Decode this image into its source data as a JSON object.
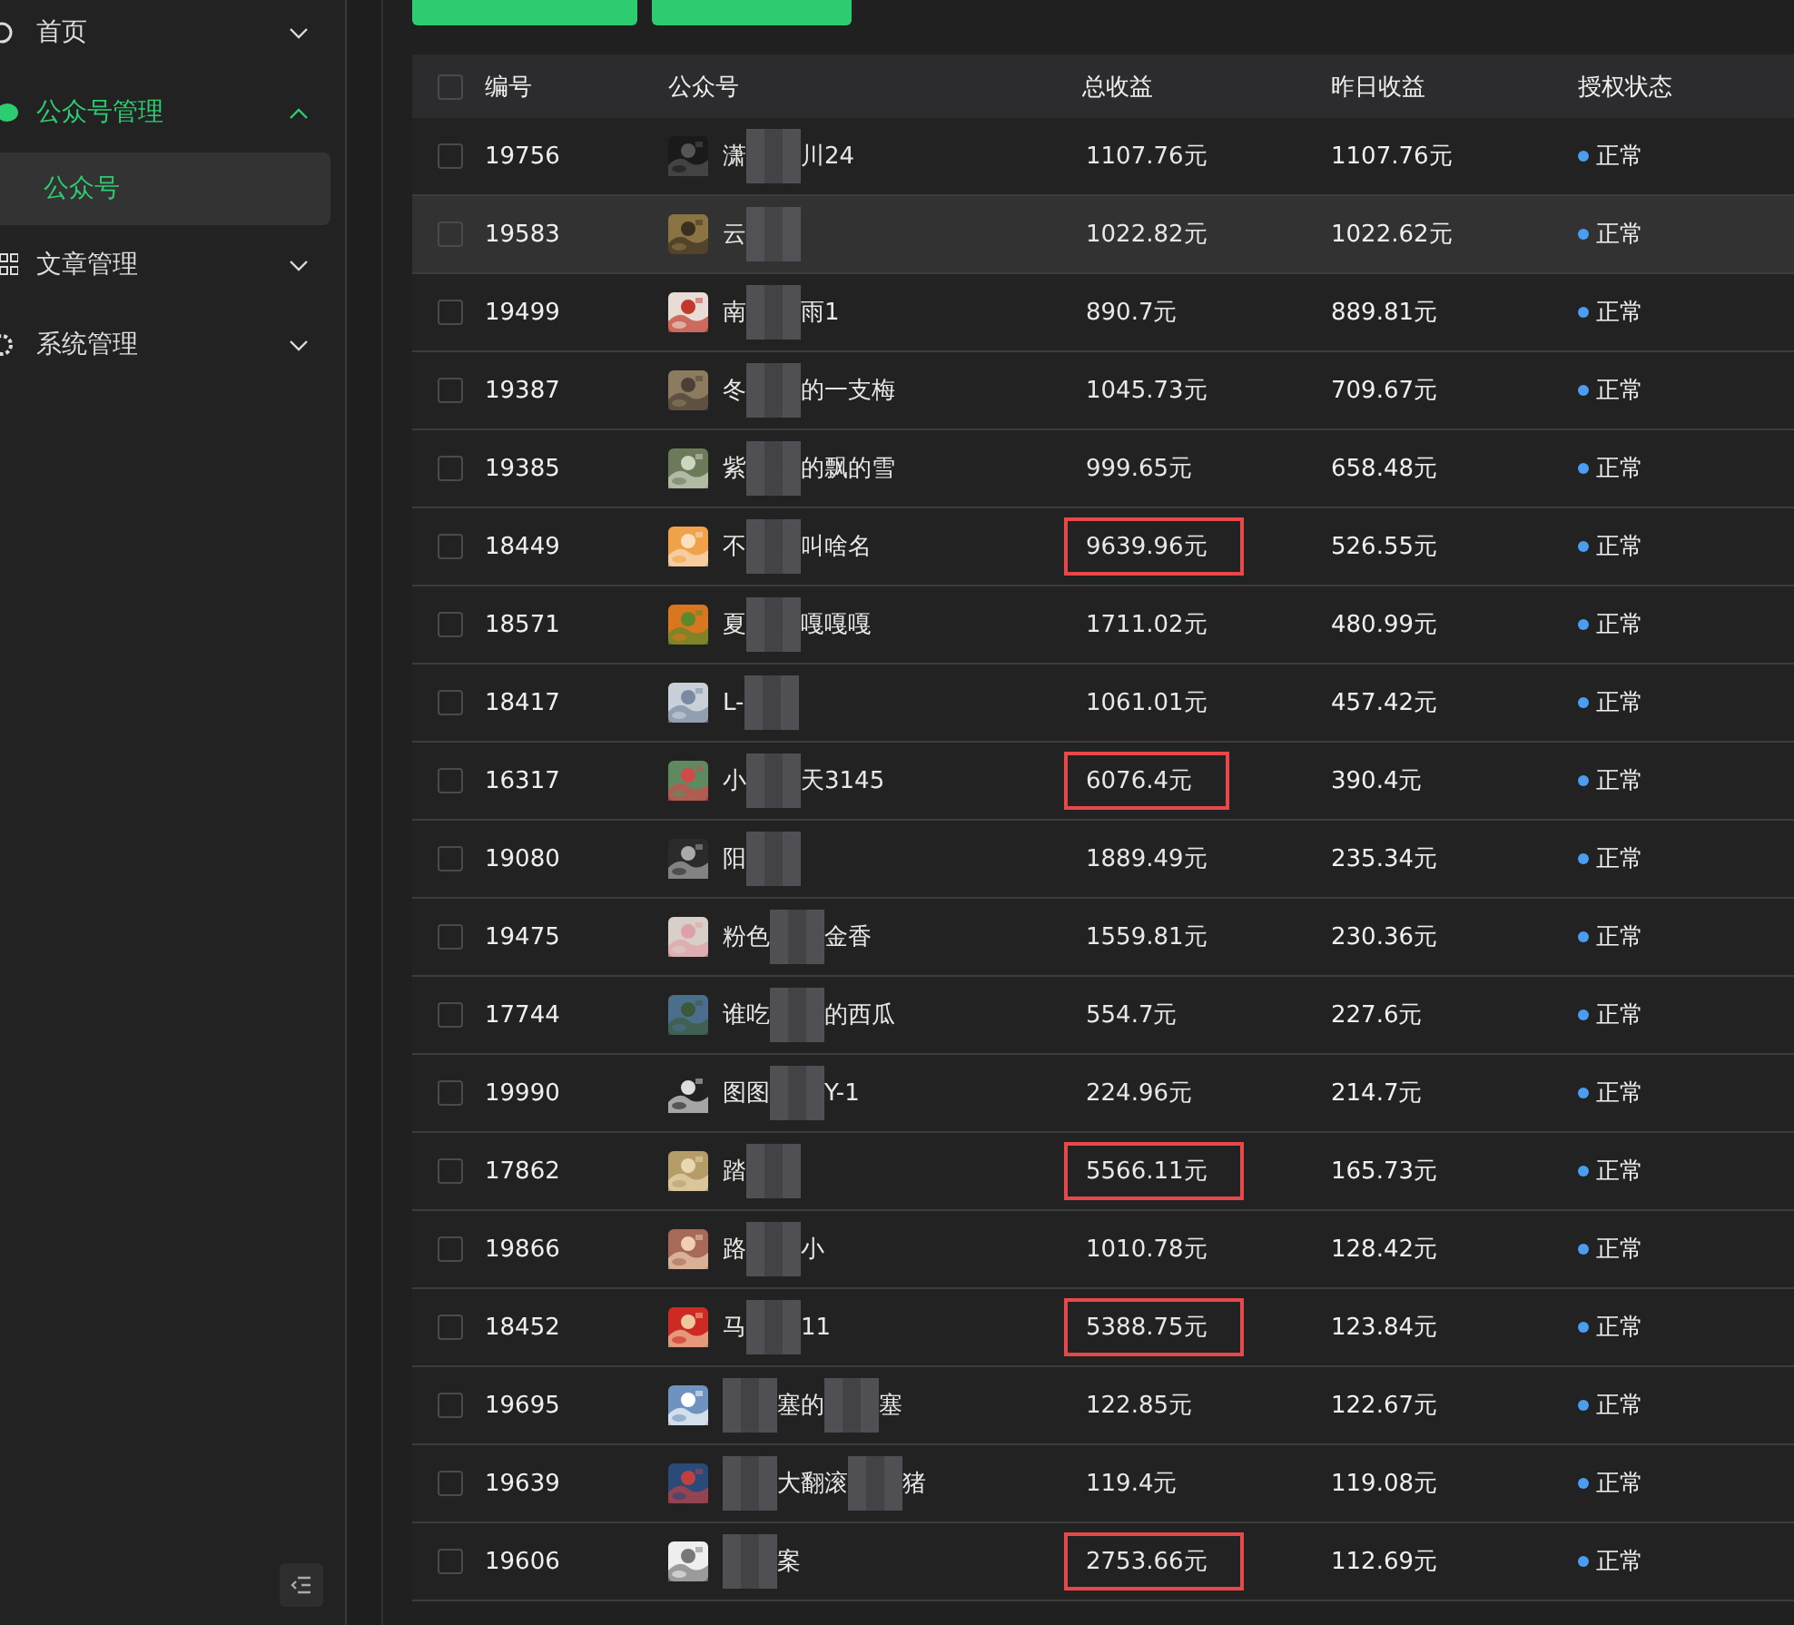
{
  "sidebar": {
    "items": [
      {
        "label": "首页",
        "kind": "home",
        "expanded": false,
        "active": false
      },
      {
        "label": "公众号管理",
        "kind": "wechat",
        "expanded": true,
        "active": true,
        "children": [
          {
            "label": "公众号",
            "selected": true
          }
        ]
      },
      {
        "label": "文章管理",
        "kind": "grid",
        "expanded": false,
        "active": false
      },
      {
        "label": "系统管理",
        "kind": "gear",
        "expanded": false,
        "active": false
      }
    ]
  },
  "table": {
    "select_all_checked": false,
    "columns": [
      "编号",
      "公众号",
      "总收益",
      "昨日收益",
      "授权状态"
    ],
    "rows": [
      {
        "id": "19756",
        "name": [
          {
            "kind": "text",
            "text": "潇"
          },
          {
            "kind": "blur"
          },
          {
            "kind": "text",
            "text": "川24"
          }
        ],
        "total": "1107.76元",
        "highlighted": false,
        "yesterday": "1107.76元",
        "status": "正常",
        "hovered": false,
        "checked": false
      },
      {
        "id": "19583",
        "name": [
          {
            "kind": "text",
            "text": "云"
          },
          {
            "kind": "blur"
          }
        ],
        "total": "1022.82元",
        "highlighted": false,
        "yesterday": "1022.62元",
        "status": "正常",
        "hovered": true,
        "checked": false
      },
      {
        "id": "19499",
        "name": [
          {
            "kind": "text",
            "text": "南"
          },
          {
            "kind": "blur"
          },
          {
            "kind": "text",
            "text": "雨1"
          }
        ],
        "total": "890.7元",
        "highlighted": false,
        "yesterday": "889.81元",
        "status": "正常",
        "hovered": false,
        "checked": false
      },
      {
        "id": "19387",
        "name": [
          {
            "kind": "text",
            "text": "冬"
          },
          {
            "kind": "blur"
          },
          {
            "kind": "text",
            "text": "的一支梅"
          }
        ],
        "total": "1045.73元",
        "highlighted": false,
        "yesterday": "709.67元",
        "status": "正常",
        "hovered": false,
        "checked": false
      },
      {
        "id": "19385",
        "name": [
          {
            "kind": "text",
            "text": "紫"
          },
          {
            "kind": "blur"
          },
          {
            "kind": "text",
            "text": "的飘的雪"
          }
        ],
        "total": "999.65元",
        "highlighted": false,
        "yesterday": "658.48元",
        "status": "正常",
        "hovered": false,
        "checked": false
      },
      {
        "id": "18449",
        "name": [
          {
            "kind": "text",
            "text": "不"
          },
          {
            "kind": "blur"
          },
          {
            "kind": "text",
            "text": "叫啥名"
          }
        ],
        "total": "9639.96元",
        "highlighted": true,
        "yesterday": "526.55元",
        "status": "正常",
        "hovered": false,
        "checked": false
      },
      {
        "id": "18571",
        "name": [
          {
            "kind": "text",
            "text": "夏"
          },
          {
            "kind": "blur"
          },
          {
            "kind": "text",
            "text": "嘎嘎嘎"
          }
        ],
        "total": "1711.02元",
        "highlighted": false,
        "yesterday": "480.99元",
        "status": "正常",
        "hovered": false,
        "checked": false
      },
      {
        "id": "18417",
        "name": [
          {
            "kind": "text",
            "text": "L-"
          },
          {
            "kind": "blur"
          }
        ],
        "total": "1061.01元",
        "highlighted": false,
        "yesterday": "457.42元",
        "status": "正常",
        "hovered": false,
        "checked": false
      },
      {
        "id": "16317",
        "name": [
          {
            "kind": "text",
            "text": "小"
          },
          {
            "kind": "blur"
          },
          {
            "kind": "text",
            "text": "天3145"
          }
        ],
        "total": "6076.4元",
        "highlighted": true,
        "yesterday": "390.4元",
        "status": "正常",
        "hovered": false,
        "checked": false
      },
      {
        "id": "19080",
        "name": [
          {
            "kind": "text",
            "text": "阳"
          },
          {
            "kind": "blur"
          }
        ],
        "total": "1889.49元",
        "highlighted": false,
        "yesterday": "235.34元",
        "status": "正常",
        "hovered": false,
        "checked": false
      },
      {
        "id": "19475",
        "name": [
          {
            "kind": "text",
            "text": "粉色"
          },
          {
            "kind": "blur"
          },
          {
            "kind": "text",
            "text": "金香"
          }
        ],
        "total": "1559.81元",
        "highlighted": false,
        "yesterday": "230.36元",
        "status": "正常",
        "hovered": false,
        "checked": false
      },
      {
        "id": "17744",
        "name": [
          {
            "kind": "text",
            "text": "谁吃"
          },
          {
            "kind": "blur"
          },
          {
            "kind": "text",
            "text": "的西瓜"
          }
        ],
        "total": "554.7元",
        "highlighted": false,
        "yesterday": "227.6元",
        "status": "正常",
        "hovered": false,
        "checked": false
      },
      {
        "id": "19990",
        "name": [
          {
            "kind": "text",
            "text": "图图"
          },
          {
            "kind": "blur"
          },
          {
            "kind": "text",
            "text": "Y-1"
          }
        ],
        "total": "224.96元",
        "highlighted": false,
        "yesterday": "214.7元",
        "status": "正常",
        "hovered": false,
        "checked": false
      },
      {
        "id": "17862",
        "name": [
          {
            "kind": "text",
            "text": "踏"
          },
          {
            "kind": "blur"
          }
        ],
        "total": "5566.11元",
        "highlighted": true,
        "yesterday": "165.73元",
        "status": "正常",
        "hovered": false,
        "checked": false
      },
      {
        "id": "19866",
        "name": [
          {
            "kind": "text",
            "text": "路"
          },
          {
            "kind": "blur"
          },
          {
            "kind": "text",
            "text": "小"
          }
        ],
        "total": "1010.78元",
        "highlighted": false,
        "yesterday": "128.42元",
        "status": "正常",
        "hovered": false,
        "checked": false
      },
      {
        "id": "18452",
        "name": [
          {
            "kind": "text",
            "text": "马"
          },
          {
            "kind": "blur"
          },
          {
            "kind": "text",
            "text": "11"
          }
        ],
        "total": "5388.75元",
        "highlighted": true,
        "yesterday": "123.84元",
        "status": "正常",
        "hovered": false,
        "checked": false
      },
      {
        "id": "19695",
        "name": [
          {
            "kind": "blur"
          },
          {
            "kind": "text",
            "text": "塞的"
          },
          {
            "kind": "blur"
          },
          {
            "kind": "text",
            "text": "塞"
          }
        ],
        "total": "122.85元",
        "highlighted": false,
        "yesterday": "122.67元",
        "status": "正常",
        "hovered": false,
        "checked": false
      },
      {
        "id": "19639",
        "name": [
          {
            "kind": "blur"
          },
          {
            "kind": "text",
            "text": "大翻滚"
          },
          {
            "kind": "blur"
          },
          {
            "kind": "text",
            "text": "猪"
          }
        ],
        "total": "119.4元",
        "highlighted": false,
        "yesterday": "119.08元",
        "status": "正常",
        "hovered": false,
        "checked": false
      },
      {
        "id": "19606",
        "name": [
          {
            "kind": "blur"
          },
          {
            "kind": "text",
            "text": "案"
          }
        ],
        "total": "2753.66元",
        "highlighted": true,
        "yesterday": "112.69元",
        "status": "正常",
        "hovered": false,
        "checked": false
      }
    ]
  }
}
